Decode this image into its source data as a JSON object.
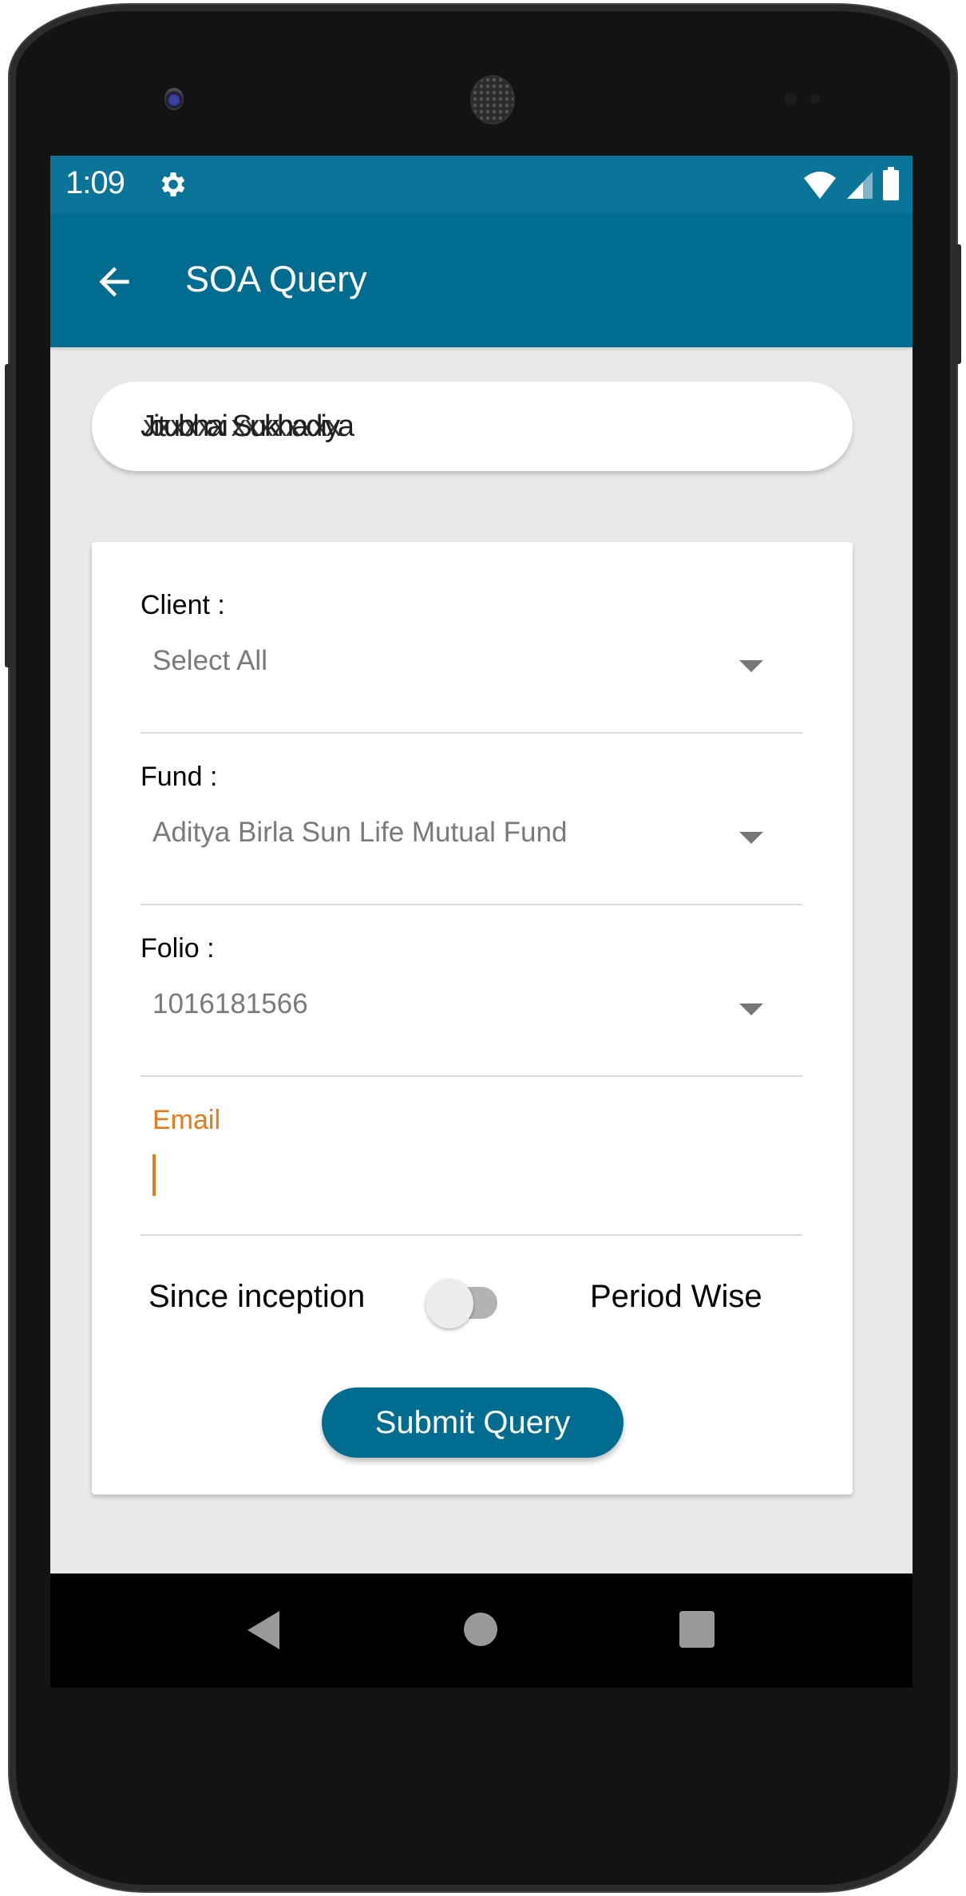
{
  "status_bar": {
    "time": "1:09",
    "icons": [
      "settings-gear-icon",
      "wifi-icon",
      "cellular-signal-icon",
      "battery-icon"
    ]
  },
  "app_bar": {
    "title": "SOA Query",
    "back_icon": "arrow-left-icon"
  },
  "user": {
    "name": "Jitubhai Sukhadiya",
    "name_overlay": "xxxxxx xxxxxxxx"
  },
  "form": {
    "client": {
      "label": "Client :",
      "value": "Select All"
    },
    "fund": {
      "label": "Fund :",
      "value": "Aditya Birla Sun Life Mutual Fund"
    },
    "folio": {
      "label": "Folio :",
      "value": "1016181566"
    },
    "email": {
      "label": "Email",
      "value": ""
    },
    "toggle": {
      "left_label": "Since inception",
      "right_label": "Period Wise",
      "checked": false
    },
    "submit_label": "Submit Query"
  },
  "colors": {
    "primary": "#006d90",
    "status_bar": "#0a7499",
    "accent": "#e57c1a",
    "background": "#e9e9e9"
  },
  "nav_bar": {
    "icons": [
      "nav-back-icon",
      "nav-home-icon",
      "nav-recents-icon"
    ]
  }
}
